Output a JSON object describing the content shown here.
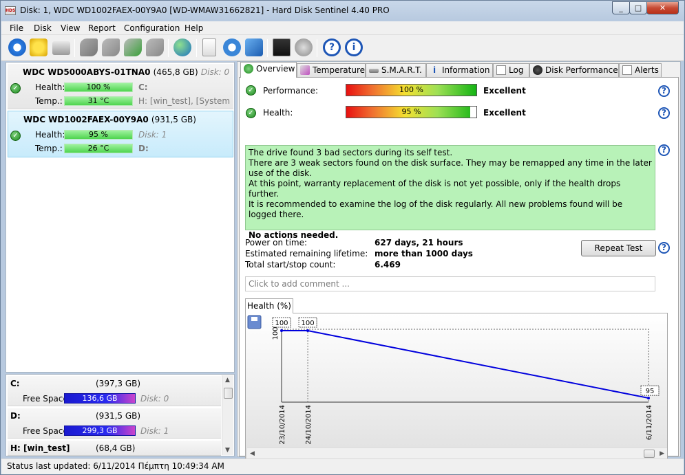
{
  "window": {
    "title": "Disk: 1, WDC WD1002FAEX-00Y9A0 [WD-WMAW31662821]  -  Hard Disk Sentinel 4.40 PRO",
    "min": "_",
    "max": "□",
    "close": "✕"
  },
  "menu": [
    "File",
    "Disk",
    "View",
    "Report",
    "Configuration",
    "Help"
  ],
  "toolbar_icons": [
    "refresh-icon",
    "warning-icon",
    "disk-icon",
    "wrench-icon",
    "wrench-add-icon",
    "wrench-check-icon",
    "wrench-remove-icon",
    "globe-icon",
    "document-icon",
    "sync-icon",
    "network-icon",
    "monitor-icon",
    "speaker-icon",
    "help-icon",
    "info-icon"
  ],
  "disks": [
    {
      "name": "WDC WD5000ABYS-01TNA0",
      "size": "(465,8 GB)",
      "disk": "Disk: 0",
      "health_label": "Health:",
      "health": "100 %",
      "temp_label": "Temp.:",
      "temp": "31 °C",
      "drive1": "C:",
      "drive2": "H: [win_test],  [System Res"
    },
    {
      "name": "WDC WD1002FAEX-00Y9A0",
      "size": "(931,5 GB)",
      "disk": "Disk: 1",
      "health_label": "Health:",
      "health": "95 %",
      "temp_label": "Temp.:",
      "temp": "26 °C",
      "drive1": "D:"
    }
  ],
  "volumes": [
    {
      "name": "C:",
      "size": "(397,3 GB)",
      "free_label": "Free Space",
      "free": "136,6 GB",
      "disk": "Disk: 0"
    },
    {
      "name": "D:",
      "size": "(931,5 GB)",
      "free_label": "Free Space",
      "free": "299,3 GB",
      "disk": "Disk: 1"
    },
    {
      "name": "H: [win_test]",
      "size": "(68,4 GB)"
    }
  ],
  "tabs": [
    "Overview",
    "Temperature",
    "S.M.A.R.T.",
    "Information",
    "Log",
    "Disk Performance",
    "Alerts"
  ],
  "overview": {
    "performance_label": "Performance:",
    "performance_value": "100 %",
    "performance_fraction": 1.0,
    "performance_verdict": "Excellent",
    "health_label": "Health:",
    "health_value": "95 %",
    "health_fraction": 0.95,
    "health_verdict": "Excellent",
    "message": [
      "The drive found 3 bad sectors during its self test.",
      "There are 3 weak sectors found on the disk surface. They may be remapped any time in the later use of the disk.",
      "At this point, warranty replacement of the disk is not yet possible, only if the health drops further.",
      "It is recommended to examine the log of the disk regularly. All new problems found will be logged there."
    ],
    "message_bold": "No actions needed.",
    "power_on_label": "Power on time:",
    "power_on_value": "627 days, 21 hours",
    "lifetime_label": "Estimated remaining lifetime:",
    "lifetime_value": "more than 1000 days",
    "startstop_label": "Total start/stop count:",
    "startstop_value": "6.469",
    "repeat_test": "Repeat Test",
    "comment_placeholder": "Click to add comment ...",
    "help": "?"
  },
  "chart_tab": "Health (%)",
  "chart_data": {
    "type": "line",
    "x": [
      "23/10/2014",
      "24/10/2014",
      "6/11/2014"
    ],
    "values": [
      100,
      100,
      95
    ],
    "data_labels": [
      "100",
      "100",
      "95"
    ],
    "y_tick_labels": [
      "100"
    ],
    "color": "#0000dd"
  },
  "status": "Status last updated: 6/11/2014 Πέμπτη 10:49:34 AM"
}
